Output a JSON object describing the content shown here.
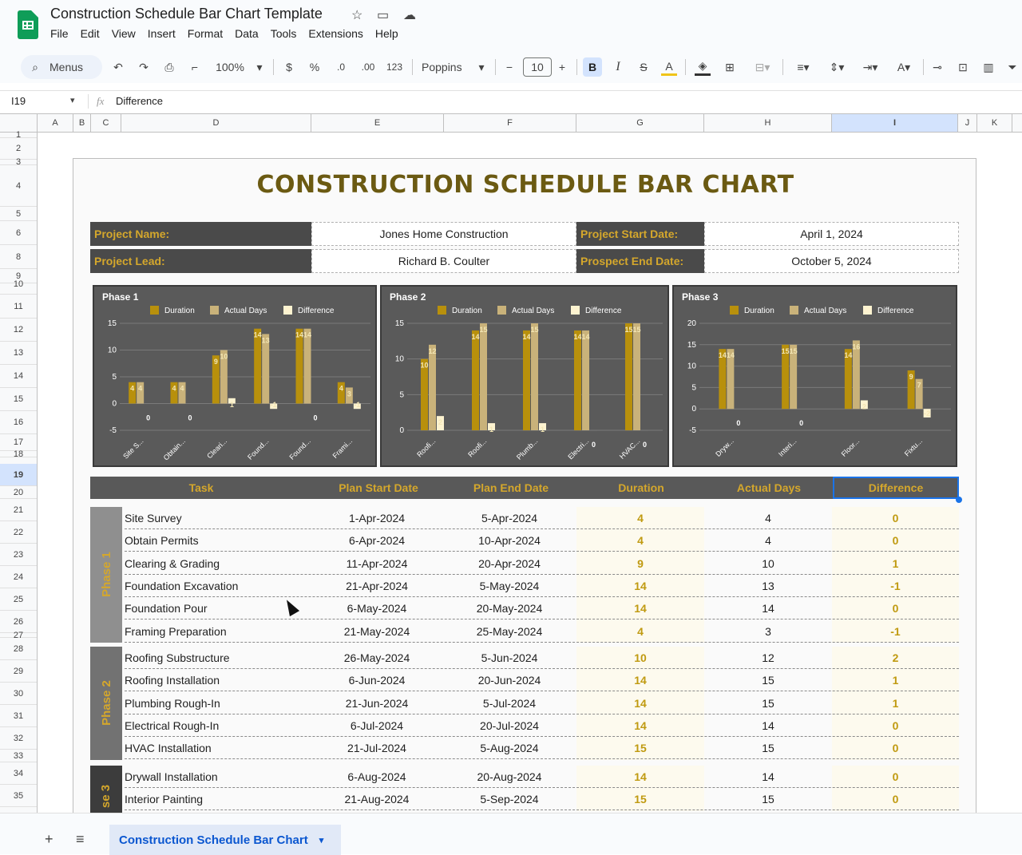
{
  "app": {
    "doc_title": "Construction Schedule Bar Chart Template",
    "menu": [
      "File",
      "Edit",
      "View",
      "Insert",
      "Format",
      "Data",
      "Tools",
      "Extensions",
      "Help"
    ]
  },
  "toolbar": {
    "search_label": "Menus",
    "zoom": "100%",
    "currency": "$",
    "percent": "%",
    "dec_minus": ".0",
    "dec_plus": ".00",
    "number_format": "123",
    "font": "Poppins",
    "font_size": "10",
    "bold": "B",
    "italic": "I",
    "strike": "S",
    "text_color": "A"
  },
  "formula_bar": {
    "cell_ref": "I19",
    "fx": "fx",
    "content": "Difference"
  },
  "columns": [
    "A",
    "B",
    "C",
    "D",
    "E",
    "F",
    "G",
    "H",
    "I",
    "J",
    "K"
  ],
  "rows": [
    "1",
    "2",
    "3",
    "4",
    "5",
    "6",
    "8",
    "9",
    "10",
    "11",
    "12",
    "13",
    "14",
    "15",
    "16",
    "17",
    "18",
    "19",
    "20",
    "21",
    "22",
    "23",
    "24",
    "25",
    "26",
    "27",
    "28",
    "29",
    "30",
    "31",
    "32",
    "33",
    "34",
    "35"
  ],
  "sheet": {
    "title": "CONSTRUCTION SCHEDULE BAR CHART",
    "project_name_label": "Project Name:",
    "project_name": "Jones Home Construction",
    "project_lead_label": "Project Lead:",
    "project_lead": "Richard B. Coulter",
    "start_label": "Project Start Date:",
    "start_date": "April 1, 2024",
    "end_label": "Prospect End Date:",
    "end_date": "October 5, 2024"
  },
  "table": {
    "headers": {
      "task": "Task",
      "start": "Plan Start Date",
      "end": "Plan End Date",
      "duration": "Duration",
      "actual": "Actual Days",
      "difference": "Difference"
    },
    "phases": [
      {
        "label": "Phase 1",
        "rows": [
          {
            "task": "Site Survey",
            "start": "1-Apr-2024",
            "end": "5-Apr-2024",
            "duration": "4",
            "actual": "4",
            "difference": "0"
          },
          {
            "task": "Obtain Permits",
            "start": "6-Apr-2024",
            "end": "10-Apr-2024",
            "duration": "4",
            "actual": "4",
            "difference": "0"
          },
          {
            "task": "Clearing & Grading",
            "start": "11-Apr-2024",
            "end": "20-Apr-2024",
            "duration": "9",
            "actual": "10",
            "difference": "1"
          },
          {
            "task": "Foundation Excavation",
            "start": "21-Apr-2024",
            "end": "5-May-2024",
            "duration": "14",
            "actual": "13",
            "difference": "-1"
          },
          {
            "task": "Foundation Pour",
            "start": "6-May-2024",
            "end": "20-May-2024",
            "duration": "14",
            "actual": "14",
            "difference": "0"
          },
          {
            "task": "Framing Preparation",
            "start": "21-May-2024",
            "end": "25-May-2024",
            "duration": "4",
            "actual": "3",
            "difference": "-1"
          }
        ]
      },
      {
        "label": "Phase 2",
        "rows": [
          {
            "task": "Roofing Substructure",
            "start": "26-May-2024",
            "end": "5-Jun-2024",
            "duration": "10",
            "actual": "12",
            "difference": "2"
          },
          {
            "task": "Roofing Installation",
            "start": "6-Jun-2024",
            "end": "20-Jun-2024",
            "duration": "14",
            "actual": "15",
            "difference": "1"
          },
          {
            "task": "Plumbing Rough-In",
            "start": "21-Jun-2024",
            "end": "5-Jul-2024",
            "duration": "14",
            "actual": "15",
            "difference": "1"
          },
          {
            "task": "Electrical Rough-In",
            "start": "6-Jul-2024",
            "end": "20-Jul-2024",
            "duration": "14",
            "actual": "14",
            "difference": "0"
          },
          {
            "task": "HVAC Installation",
            "start": "21-Jul-2024",
            "end": "5-Aug-2024",
            "duration": "15",
            "actual": "15",
            "difference": "0"
          }
        ]
      },
      {
        "label": "se 3",
        "rows": [
          {
            "task": "Drywall Installation",
            "start": "6-Aug-2024",
            "end": "20-Aug-2024",
            "duration": "14",
            "actual": "14",
            "difference": "0"
          },
          {
            "task": "Interior Painting",
            "start": "21-Aug-2024",
            "end": "5-Sep-2024",
            "duration": "15",
            "actual": "15",
            "difference": "0"
          }
        ]
      }
    ]
  },
  "chart_data": [
    {
      "type": "bar",
      "title": "Phase 1",
      "categories": [
        "Site S...",
        "Obtain...",
        "Cleari...",
        "Found...",
        "Found...",
        "Frami..."
      ],
      "series": [
        {
          "name": "Duration",
          "values": [
            4,
            4,
            9,
            14,
            14,
            4
          ],
          "color": "#b8900c"
        },
        {
          "name": "Actual Days",
          "values": [
            4,
            4,
            10,
            13,
            14,
            3
          ],
          "color": "#c9b27a"
        },
        {
          "name": "Difference",
          "values": [
            0,
            0,
            1,
            -1,
            0,
            -1
          ],
          "color": "#fdf3d0"
        }
      ],
      "ylim": [
        -5,
        15
      ],
      "yticks": [
        -5,
        0,
        5,
        10,
        15
      ]
    },
    {
      "type": "bar",
      "title": "Phase 2",
      "categories": [
        "Roofi...",
        "Roofi...",
        "Plumb...",
        "Electri...",
        "HVAC..."
      ],
      "series": [
        {
          "name": "Duration",
          "values": [
            10,
            14,
            14,
            14,
            15
          ],
          "color": "#b8900c"
        },
        {
          "name": "Actual Days",
          "values": [
            12,
            15,
            15,
            14,
            15
          ],
          "color": "#c9b27a"
        },
        {
          "name": "Difference",
          "values": [
            2,
            1,
            1,
            0,
            0
          ],
          "color": "#fdf3d0"
        }
      ],
      "ylim": [
        0,
        15
      ],
      "yticks": [
        0,
        5,
        10,
        15
      ]
    },
    {
      "type": "bar",
      "title": "Phase 3",
      "categories": [
        "Dryw...",
        "Interi...",
        "Floor...",
        "Fixtu..."
      ],
      "series": [
        {
          "name": "Duration",
          "values": [
            14,
            15,
            14,
            9
          ],
          "color": "#b8900c"
        },
        {
          "name": "Actual Days",
          "values": [
            14,
            15,
            16,
            7
          ],
          "color": "#c9b27a"
        },
        {
          "name": "Difference",
          "values": [
            0,
            0,
            2,
            -2
          ],
          "color": "#fdf3d0"
        }
      ],
      "ylim": [
        -5,
        20
      ],
      "yticks": [
        -5,
        0,
        5,
        10,
        15,
        20
      ]
    }
  ],
  "bottom": {
    "sheet_tab": "Construction Schedule Bar Chart"
  }
}
